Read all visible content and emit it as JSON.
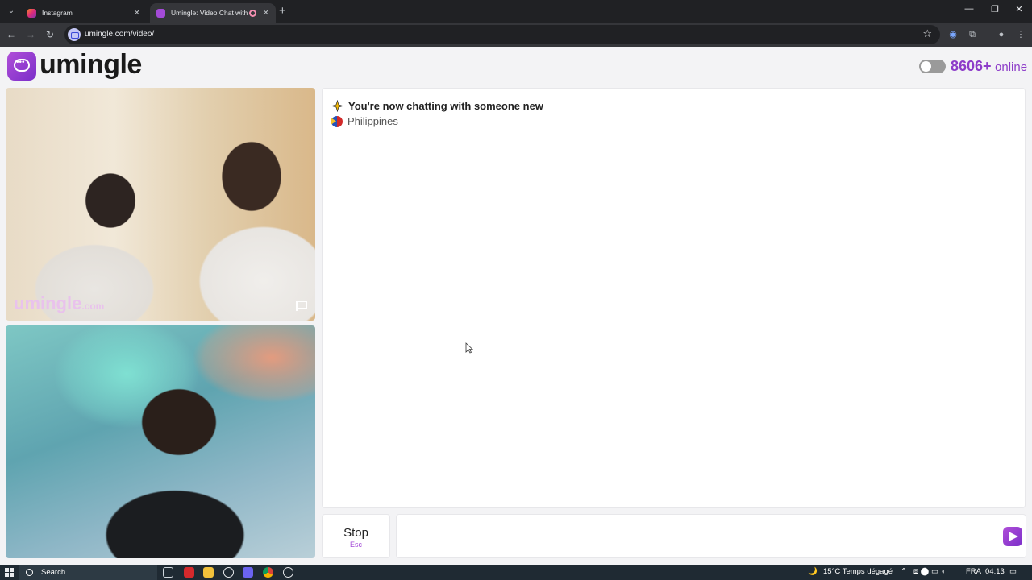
{
  "browser": {
    "tabs": [
      {
        "title": "Instagram",
        "favicon_color": "#e1306c",
        "active": false
      },
      {
        "title": "Umingle: Video Chat with S",
        "favicon_color": "#a44bd8",
        "active": true
      }
    ],
    "new_tab": "+",
    "address": "umingle.com/video/",
    "window_controls": {
      "minimize": "—",
      "maximize": "❐",
      "close": "✕"
    }
  },
  "header": {
    "logo_text": "umingle",
    "online_count": "8606+",
    "online_label": "online",
    "brand_color": "#8d3cc9"
  },
  "videos": {
    "stranger_watermark": "umingle",
    "stranger_watermark_suffix": ".com"
  },
  "chat": {
    "messages": [
      {
        "text": "You're now chatting with someone new",
        "icon": "sparkle-icon"
      },
      {
        "text": "Philippines",
        "icon": "philippines-flag-icon"
      }
    ]
  },
  "controls": {
    "stop_label": "Stop",
    "stop_shortcut": "Esc",
    "message_placeholder": ""
  },
  "taskbar": {
    "search_label": "Search",
    "weather": "15°C  Temps dégagé",
    "language": "FRA",
    "time": "04:13"
  }
}
